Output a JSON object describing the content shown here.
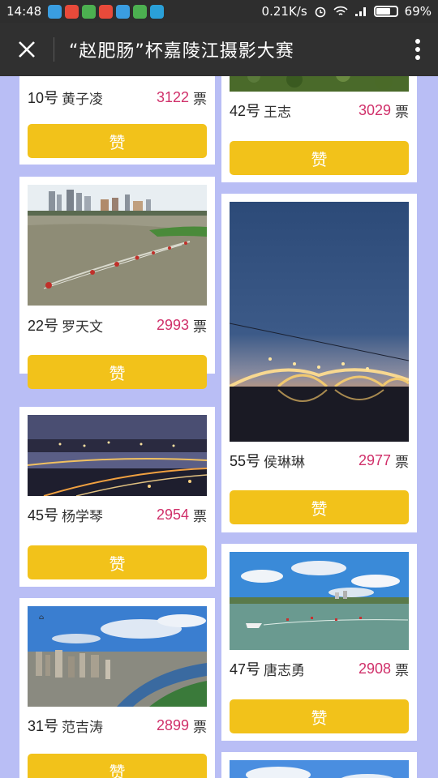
{
  "status_bar": {
    "time": "14:48",
    "network_speed": "0.21K/s",
    "battery": "69%",
    "app_icons": [
      "#3a9de0",
      "#e84a3a",
      "#4cb050",
      "#e84a3a",
      "#3a9de0",
      "#4cb050",
      "#2aa0d8"
    ]
  },
  "nav": {
    "title": "“赵肥肠”杯嘉陵江摄影大赛"
  },
  "unit_label": "票",
  "like_label": "赞",
  "colors": {
    "page_bg": "#b9bef5",
    "button": "#f2c21a",
    "votes": "#d0306a",
    "nav_bg": "#303030"
  },
  "entries": {
    "c10": {
      "number": "10号",
      "name": "黄子凌",
      "votes": "3122"
    },
    "c22": {
      "number": "22号",
      "name": "罗天文",
      "votes": "2993"
    },
    "c45": {
      "number": "45号",
      "name": "杨学琴",
      "votes": "2954"
    },
    "c31": {
      "number": "31号",
      "name": "范吉涛",
      "votes": "2899"
    },
    "c42": {
      "number": "42号",
      "name": "王志",
      "votes": "3029"
    },
    "c55": {
      "number": "55号",
      "name": "侯琳琳",
      "votes": "2977"
    },
    "c47": {
      "number": "47号",
      "name": "唐志勇",
      "votes": "2908"
    }
  }
}
